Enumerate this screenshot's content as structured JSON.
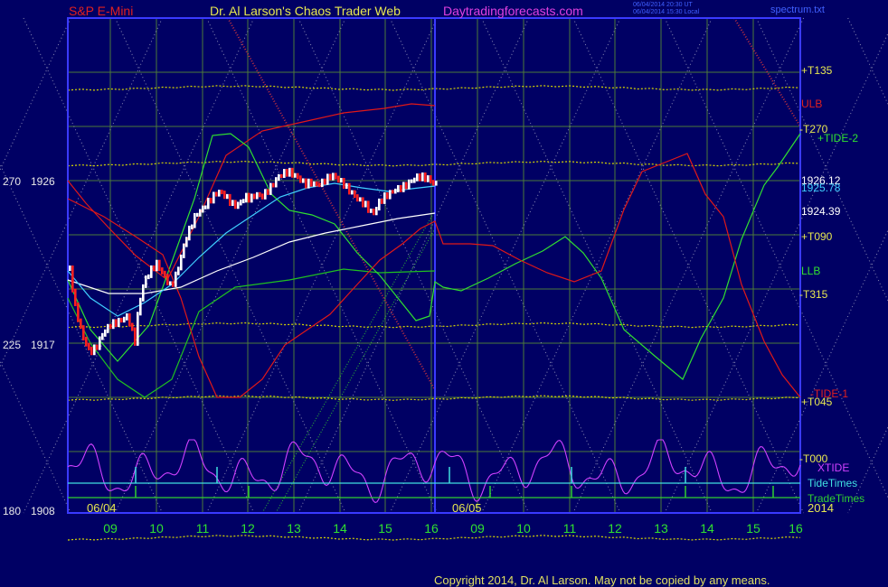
{
  "header": {
    "symbol": "S&P E-Mini",
    "site": "Dr. Al Larson's Chaos Trader Web",
    "url": "Daytradingforecasts.com",
    "stamp1": "06/04/2014 20:30 UT",
    "stamp2": "06/04/2014 15:30 Local",
    "file": "spectrum.txt"
  },
  "colors": {
    "background": "#000064",
    "grid": "#4d7a3a",
    "frame": "#3a3aff",
    "price_up": "#ffffff",
    "price_down": "#ff2020",
    "t_lines": "#d8d800",
    "ulb": "#e01818",
    "llb": "#20c020",
    "tide1": "#e01818",
    "tide2": "#30e030",
    "xtide": "#d040ff",
    "tidetimes": "#40e0e0",
    "tradetimes": "#30d030",
    "ma_fast": "#40d0ff",
    "ma_slow": "#ffffff"
  },
  "chart_data": {
    "type": "line",
    "title": "S&P E-Mini",
    "y_axis": {
      "ticks": [
        {
          "angle": "270",
          "price": "1926",
          "value": 1926
        },
        {
          "angle": "225",
          "price": "1917",
          "value": 1917
        },
        {
          "angle": "180",
          "price": "1908",
          "value": 1908
        }
      ],
      "range": [
        1908,
        1942
      ]
    },
    "x_axis": {
      "hour_labels": [
        "09",
        "10",
        "11",
        "12",
        "13",
        "14",
        "15",
        "16",
        "09",
        "10",
        "11",
        "12",
        "13",
        "14",
        "15",
        "16"
      ],
      "date_labels": [
        "06/04",
        "06/05",
        "2014"
      ]
    },
    "right_labels": [
      {
        "text": "+T135",
        "color": "#e8e850",
        "value": 1937.2
      },
      {
        "text": "ULB",
        "color": "#e02020",
        "value": 1934.8
      },
      {
        "text": "-T270",
        "color": "#e8e850",
        "value": 1932.0
      },
      {
        "text": "+TIDE-2",
        "color": "#30e030",
        "value": 1931.0
      },
      {
        "text": "1926.12",
        "color": "#ffffff",
        "value": 1926.12
      },
      {
        "text": "1925.78",
        "color": "#40d0ff",
        "value": 1925.78
      },
      {
        "text": "1924.39",
        "color": "#ffffff",
        "value": 1924.39
      },
      {
        "text": "+T090",
        "color": "#e8e850",
        "value": 1920.9
      },
      {
        "text": "LLB",
        "color": "#30e030",
        "value": 1918.6
      },
      {
        "text": "-T315",
        "color": "#e8e850",
        "value": 1915.9
      },
      {
        "text": "-TIDE-1",
        "color": "#e02020",
        "value": 1907.6
      },
      {
        "text": "+T045",
        "color": "#e8e850",
        "value": 1906.3
      },
      {
        "text": "-T000",
        "color": "#e8e850",
        "value": 1902.4
      },
      {
        "text": "XTIDE",
        "color": "#d040ff",
        "value": 1901.5
      },
      {
        "text": "TideTimes",
        "color": "#40e0e0",
        "value": 1900.7
      },
      {
        "text": "TradeTimes",
        "color": "#30d030",
        "value": 1899.8
      }
    ],
    "last_price": 1926.12,
    "ma_fast_last": 1925.78,
    "ma_slow_last": 1924.39,
    "t_levels": [
      {
        "name": "+T135",
        "value": 1937.2
      },
      {
        "name": "-T270",
        "value": 1932.0
      },
      {
        "name": "+T090",
        "value": 1920.9
      },
      {
        "name": "-T315",
        "value": 1915.9
      },
      {
        "name": "+T045",
        "value": 1906.3
      },
      {
        "name": "-T000",
        "value": 1902.4
      }
    ],
    "copyright": "Copyright 2014, Dr. Al Larson. May not be copied by any means."
  }
}
